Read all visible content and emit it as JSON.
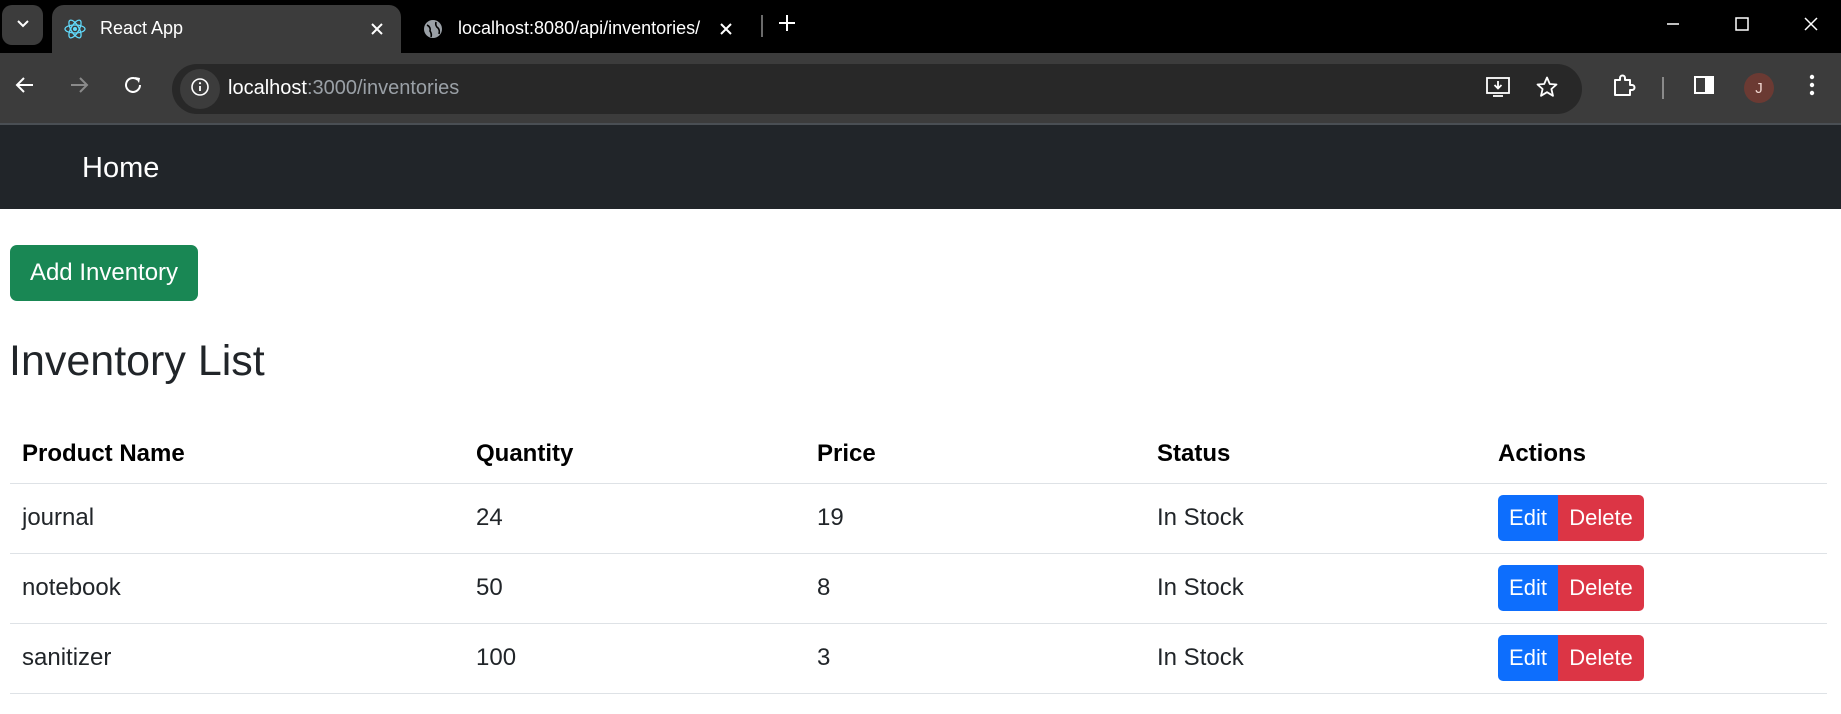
{
  "browser": {
    "tabs": [
      {
        "title": "React App",
        "icon": "react-icon",
        "active": true
      },
      {
        "title": "localhost:8080/api/inventories/",
        "icon": "globe-icon",
        "active": false
      }
    ],
    "url": {
      "host": "localhost",
      "path": ":3000/inventories"
    },
    "profile_initial": "J"
  },
  "navbar": {
    "home_label": "Home"
  },
  "main": {
    "add_button_label": "Add Inventory",
    "title": "Inventory List"
  },
  "table": {
    "headers": [
      "Product Name",
      "Quantity",
      "Price",
      "Status",
      "Actions"
    ],
    "rows": [
      {
        "product": "journal",
        "quantity": "24",
        "price": "19",
        "status": "In Stock"
      },
      {
        "product": "notebook",
        "quantity": "50",
        "price": "8",
        "status": "In Stock"
      },
      {
        "product": "sanitizer",
        "quantity": "100",
        "price": "3",
        "status": "In Stock"
      }
    ],
    "edit_label": "Edit",
    "delete_label": "Delete"
  },
  "colors": {
    "navbar_bg": "#212529",
    "add_button": "#198754",
    "edit_button": "#0d6efd",
    "delete_button": "#dc3545"
  }
}
